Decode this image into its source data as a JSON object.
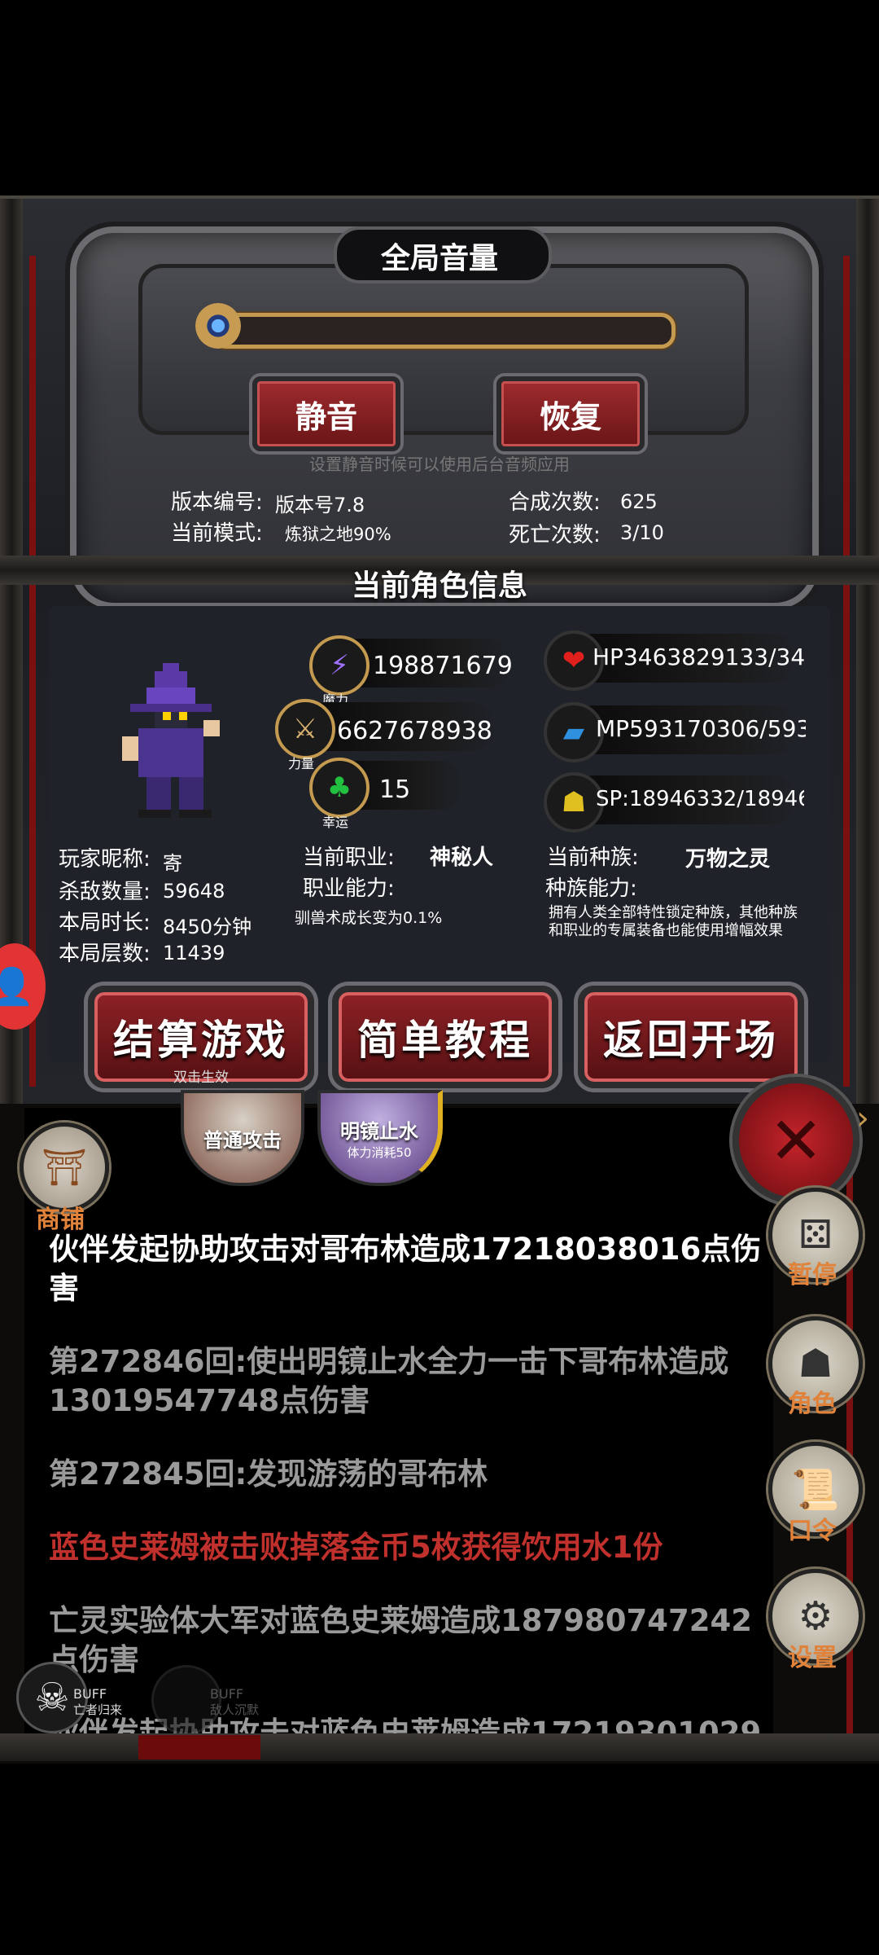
{
  "volume": {
    "title": "全局音量",
    "mute_label": "静音",
    "restore_label": "恢复",
    "hint": "设置静音时候可以使用后台音频应用"
  },
  "info": {
    "version_label": "版本编号:",
    "version_value": "版本号7.8",
    "synth_label": "合成次数:",
    "synth_value": "625",
    "mode_label": "当前模式:",
    "mode_value": "炼狱之地90%",
    "death_label": "死亡次数:",
    "death_value": "3/10"
  },
  "character": {
    "header": "当前角色信息",
    "magic_value": "198871679",
    "magic_label": "魔力",
    "strength_value": "6627678938",
    "strength_label": "力量",
    "luck_value": "15",
    "luck_label": "幸运",
    "hp": "HP3463829133/34",
    "mp": "MP593170306/593",
    "sp": "SP:18946332/18946",
    "nickname_label": "玩家昵称:",
    "nickname_value": "寄",
    "kills_label": "杀敌数量:",
    "kills_value": "59648",
    "duration_label": "本局时长:",
    "duration_value": "8450分钟",
    "floors_label": "本局层数:",
    "floors_value": "11439",
    "job_label": "当前职业:",
    "job_value": "神秘人",
    "job_ability_label": "职业能力:",
    "job_ability_value": "驯兽术成长变为0.1%",
    "race_label": "当前种族:",
    "race_value": "万物之灵",
    "race_ability_label": "种族能力:",
    "race_ability_value": "拥有人类全部特性锁定种族，其他种族和职业的专属装备也能使用增幅效果"
  },
  "actions": {
    "settle": "结算游戏",
    "settle_sub": "双击生效",
    "tutorial": "简单教程",
    "back": "返回开场"
  },
  "skills": {
    "normal_attack": "普通攻击",
    "mirror": "明镜止水",
    "mirror_sub": "体力消耗50"
  },
  "side": {
    "shop": "商铺",
    "pause": "暂停",
    "role": "角色",
    "password": "口令",
    "settings": "设置"
  },
  "buffs": {
    "buff1_label": "BUFF",
    "buff1_name": "亡者归来",
    "buff2_label": "BUFF",
    "buff2_name": "敌人沉默"
  },
  "log": [
    {
      "text": "伙伴发起协助攻击对哥布林造成17218038016点伤害",
      "color": "#ffffff"
    },
    {
      "text": "第272846回:使出明镜止水全力一击下哥布林造成13019547748点伤害",
      "color": "#9a9a9a"
    },
    {
      "text": "第272845回:发现游荡的哥布林",
      "color": "#9a9a9a"
    },
    {
      "text": "蓝色史莱姆被击败掉落金币5枚获得饮用水1份",
      "color": "#c0302c"
    },
    {
      "text": "亡灵实验体大军对蓝色史莱姆造成187980747242点伤害",
      "color": "#9a9a9a"
    },
    {
      "text": "伙伴发起协助攻击对蓝色史莱姆造成17219301029",
      "color": "#9a9a9a"
    }
  ]
}
